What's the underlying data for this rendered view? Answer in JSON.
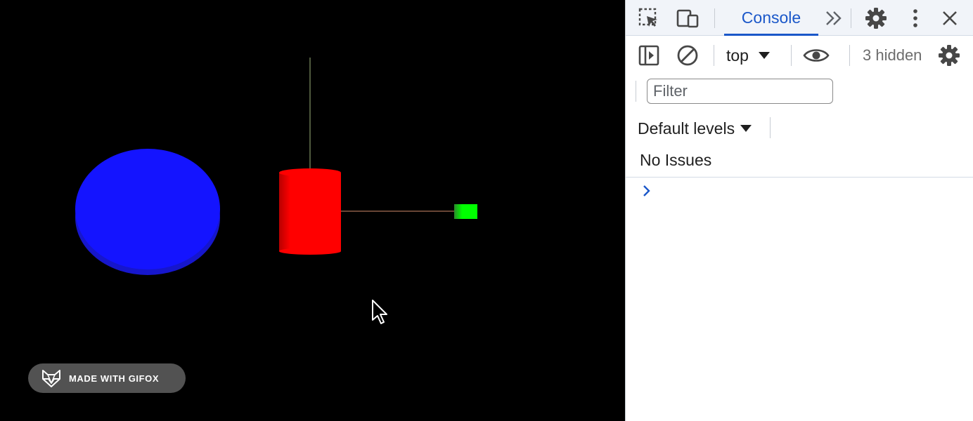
{
  "viewport": {
    "background": "#000000",
    "objects": [
      {
        "name": "blue-ellipsoid",
        "color": "#1414ff"
      },
      {
        "name": "red-cylinder",
        "color": "#ff0000"
      },
      {
        "name": "green-cube",
        "color": "#00ff00"
      }
    ],
    "watermark": {
      "text": "MADE WITH GIFOX",
      "icon": "fox-icon"
    }
  },
  "devtools": {
    "tabbar": {
      "inspect_icon": "inspect-element-icon",
      "device_icon": "device-toolbar-icon",
      "active_tab": "Console",
      "more_tabs_icon": "double-chevron-right-icon",
      "settings_icon": "gear-icon",
      "menu_icon": "kebab-menu-icon",
      "close_icon": "close-icon",
      "accent": "#1a57c9"
    },
    "toolbar": {
      "sidebar_icon": "sidebar-toggle-icon",
      "clear_icon": "clear-console-icon",
      "context": "top",
      "eye_icon": "eye-icon",
      "hidden_count": "3 hidden",
      "settings_icon": "gear-icon"
    },
    "filter": {
      "placeholder": "Filter",
      "value": ""
    },
    "levels": {
      "label": "Default levels"
    },
    "issues": {
      "label": "No Issues"
    },
    "prompt_icon": "chevron-right-icon"
  }
}
